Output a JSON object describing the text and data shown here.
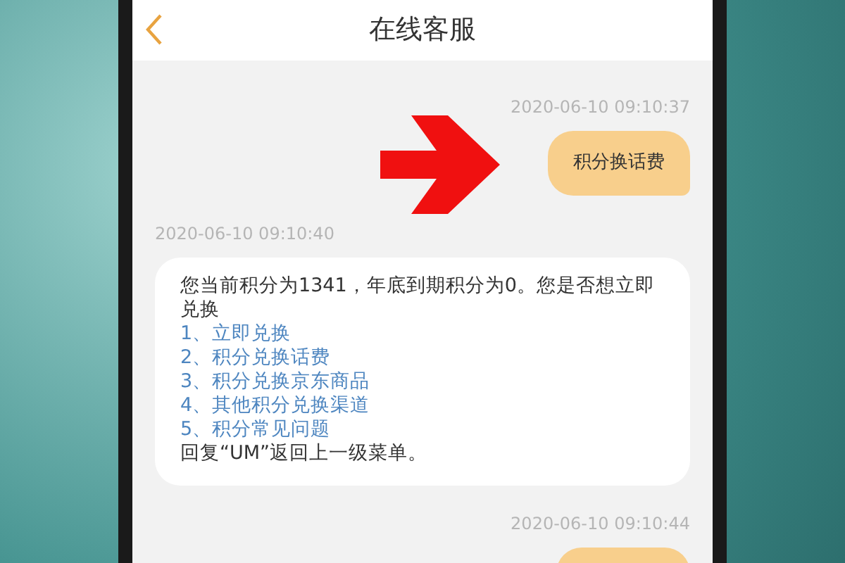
{
  "header": {
    "title": "在线客服"
  },
  "messages": [
    {
      "kind": "outgoing",
      "timestamp": "2020-06-10 09:10:37",
      "text": "积分换话费"
    },
    {
      "kind": "incoming",
      "timestamp": "2020-06-10 09:10:40",
      "text": "您当前积分为1341，年底到期积分为0。您是否想立即兑换",
      "options": [
        "1、立即兑换",
        "2、积分兑换话费",
        "3、积分兑换京东商品",
        "4、其他积分兑换渠道",
        "5、积分常见问题"
      ],
      "footer": "回复“UM”返回上一级菜单。"
    },
    {
      "kind": "outgoing",
      "timestamp": "2020-06-10 09:10:44"
    }
  ]
}
